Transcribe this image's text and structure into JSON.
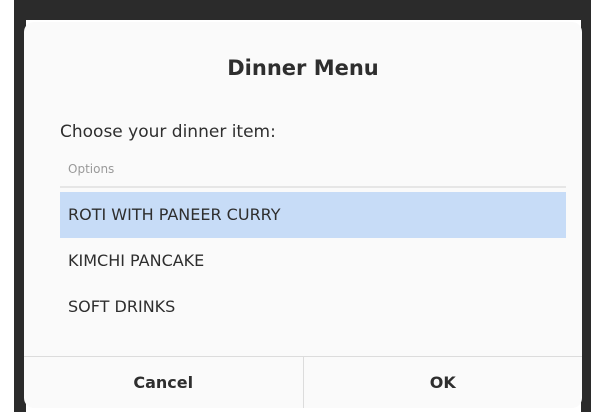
{
  "dialog": {
    "title": "Dinner Menu",
    "prompt": "Choose your dinner item:",
    "column_header": "Options",
    "options": [
      {
        "label": "ROTI WITH PANEER CURRY",
        "selected": true
      },
      {
        "label": "KIMCHI PANCAKE",
        "selected": false
      },
      {
        "label": "SOFT DRINKS",
        "selected": false
      }
    ],
    "cancel_label": "Cancel",
    "ok_label": "OK"
  },
  "colors": {
    "selection": "#c7dcf7",
    "dialog_background": "#fafafa",
    "backdrop": "#2b2b2b",
    "text": "#2e2e2e",
    "header_text": "#9a9a9a"
  }
}
